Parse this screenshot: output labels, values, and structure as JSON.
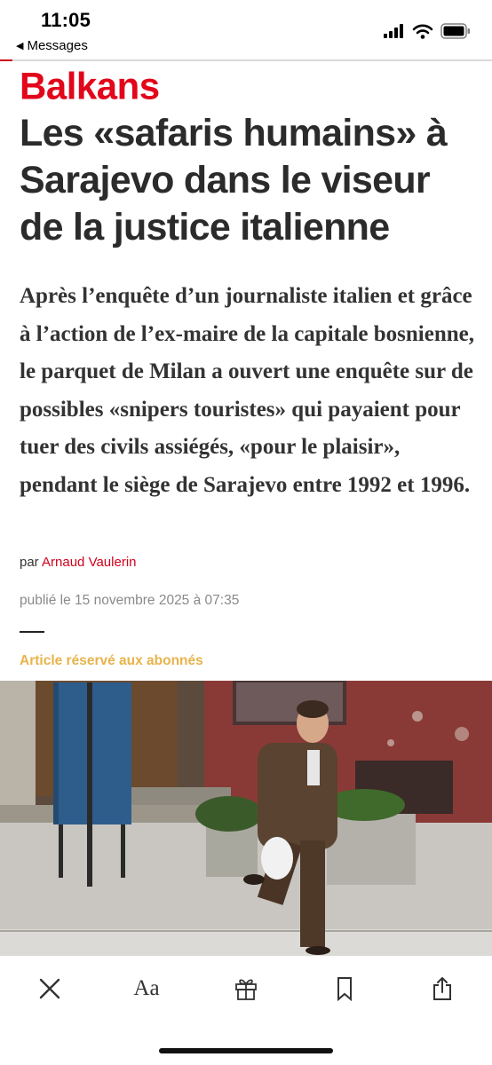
{
  "status_bar": {
    "time": "11:05",
    "back_label": "Messages"
  },
  "article": {
    "kicker": "Balkans",
    "headline": "Les «safaris humains» à Sarajevo dans le viseur de la justice italienne",
    "standfirst": "Après l’enquête d’un journaliste italien et grâce à l’action de l’ex-maire de la capitale bosnienne, le parquet de Milan a ouvert une enquête sur de possibles «snipers touristes» qui payaient pour tuer des civils assiégés, «pour le plaisir», pendant le siège de Sarajevo entre 1992 et 1996.",
    "byline_prefix": "par",
    "author": "Arnaud Vaulerin",
    "published": "publié le 15 novembre 2025 à 07:35",
    "subscriber_note": "Article réservé aux abonnés"
  },
  "toolbar": {
    "items": [
      "close-icon",
      "text-size-icon",
      "gift-icon",
      "bookmark-icon",
      "share-icon"
    ],
    "text_size_label": "Aa"
  },
  "colors": {
    "accent_red": "#e2061b",
    "headline": "#2b2b2b",
    "subscriber": "#e8b34a"
  }
}
